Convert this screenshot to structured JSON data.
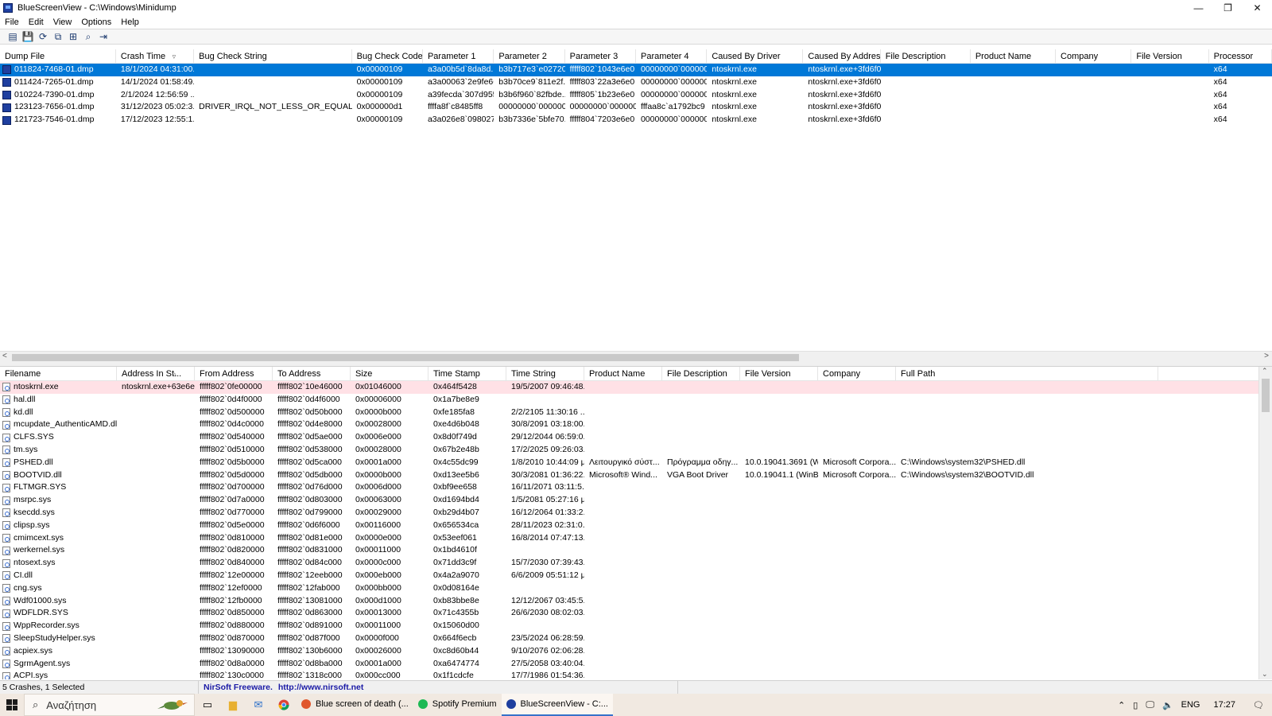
{
  "window": {
    "title": "BlueScreenView  -  C:\\Windows\\Minidump",
    "minimize": "—",
    "restore": "❐",
    "close": "✕"
  },
  "menu": [
    "File",
    "Edit",
    "View",
    "Options",
    "Help"
  ],
  "toolbar": {
    "buttons": [
      {
        "name": "html-report-icon",
        "glyph": "▤"
      },
      {
        "name": "save-icon",
        "glyph": "💾"
      },
      {
        "name": "refresh-icon",
        "glyph": "⟳"
      },
      {
        "name": "copy-icon",
        "glyph": "⧉"
      },
      {
        "name": "properties-icon",
        "glyph": "⊞"
      },
      {
        "name": "find-icon",
        "glyph": "⌕"
      },
      {
        "name": "exit-icon",
        "glyph": "⇥"
      }
    ]
  },
  "crashes": {
    "columns": [
      "Dump File",
      "Crash Time",
      "Bug Check String",
      "Bug Check Code",
      "Parameter 1",
      "Parameter 2",
      "Parameter 3",
      "Parameter 4",
      "Caused By Driver",
      "Caused By Address",
      "File Description",
      "Product Name",
      "Company",
      "File Version",
      "Processor"
    ],
    "sort_indicator": "▿",
    "rows": [
      [
        "011824-7468-01.dmp",
        "18/1/2024 04:31:00...",
        "",
        "0x00000109",
        "a3a00b5d`8da8d...",
        "b3b717e3`e02720...",
        "fffff802`1043e6e0",
        "00000000`000000...",
        "ntoskrnl.exe",
        "ntoskrnl.exe+3fd6f0",
        "",
        "",
        "",
        "",
        "x64"
      ],
      [
        "011424-7265-01.dmp",
        "14/1/2024 01:58:49...",
        "",
        "0x00000109",
        "a3a00063`2e9fe66c",
        "b3b70ce9`811e2f...",
        "fffff803`22a3e6e0",
        "00000000`000000...",
        "ntoskrnl.exe",
        "ntoskrnl.exe+3fd6f0",
        "",
        "",
        "",
        "",
        "x64"
      ],
      [
        "010224-7390-01.dmp",
        "2/1/2024 12:56:59 ...",
        "",
        "0x00000109",
        "a39fecda`307d955f",
        "b3b6f960`82fbde...",
        "fffff805`1b23e6e0",
        "00000000`000000...",
        "ntoskrnl.exe",
        "ntoskrnl.exe+3fd6f0",
        "",
        "",
        "",
        "",
        "x64"
      ],
      [
        "123123-7656-01.dmp",
        "31/12/2023 05:02:3...",
        "DRIVER_IRQL_NOT_LESS_OR_EQUAL",
        "0x000000d1",
        "ffffa8f`c8485ff8",
        "00000000`000000...",
        "00000000`000000...",
        "fffaa8c`a1792bc9",
        "ntoskrnl.exe",
        "ntoskrnl.exe+3fd6f0",
        "",
        "",
        "",
        "",
        "x64"
      ],
      [
        "121723-7546-01.dmp",
        "17/12/2023 12:55:1...",
        "",
        "0x00000109",
        "a3a026e8`098027...",
        "b3b7336e`5bfe70...",
        "fffff804`7203e6e0",
        "00000000`000000...",
        "ntoskrnl.exe",
        "ntoskrnl.exe+3fd6f0",
        "",
        "",
        "",
        "",
        "x64"
      ]
    ]
  },
  "drivers": {
    "columns": [
      "Filename",
      "Address In St...",
      "From Address",
      "To Address",
      "Size",
      "Time Stamp",
      "Time String",
      "Product Name",
      "File Description",
      "File Version",
      "Company",
      "Full Path"
    ],
    "sort_indicator": "▵",
    "rows": [
      [
        "ntoskrnl.exe",
        "ntoskrnl.exe+63e6e0",
        "fffff802`0fe00000",
        "fffff802`10e46000",
        "0x01046000",
        "0x464f5428",
        "19/5/2007 09:46:48...",
        "",
        "",
        "",
        "",
        ""
      ],
      [
        "hal.dll",
        "",
        "fffff802`0d4f0000",
        "fffff802`0d4f6000",
        "0x00006000",
        "0x1a7be8e9",
        "",
        "",
        "",
        "",
        "",
        ""
      ],
      [
        "kd.dll",
        "",
        "fffff802`0d500000",
        "fffff802`0d50b000",
        "0x0000b000",
        "0xfe185fa8",
        "2/2/2105 11:30:16 ...",
        "",
        "",
        "",
        "",
        ""
      ],
      [
        "mcupdate_AuthenticAMD.dll",
        "",
        "fffff802`0d4c0000",
        "fffff802`0d4e8000",
        "0x00028000",
        "0xe4d6b048",
        "30/8/2091 03:18:00...",
        "",
        "",
        "",
        "",
        ""
      ],
      [
        "CLFS.SYS",
        "",
        "fffff802`0d540000",
        "fffff802`0d5ae000",
        "0x0006e000",
        "0x8d0f749d",
        "29/12/2044 06:59:0...",
        "",
        "",
        "",
        "",
        ""
      ],
      [
        "tm.sys",
        "",
        "fffff802`0d510000",
        "fffff802`0d538000",
        "0x00028000",
        "0x67b2e48b",
        "17/2/2025 09:26:03...",
        "",
        "",
        "",
        "",
        ""
      ],
      [
        "PSHED.dll",
        "",
        "fffff802`0d5b0000",
        "fffff802`0d5ca000",
        "0x0001a000",
        "0x4c55dc99",
        "1/8/2010 10:44:09 μμ",
        "Λειτουργικό σύστ...",
        "Πρόγραμμα οδηγ...",
        "10.0.19041.3691 (W...",
        "Microsoft Corpora...",
        "C:\\Windows\\system32\\PSHED.dll"
      ],
      [
        "BOOTVID.dll",
        "",
        "fffff802`0d5d0000",
        "fffff802`0d5db000",
        "0x0000b000",
        "0xd13ee5b6",
        "30/3/2081 01:36:22...",
        "Microsoft® Wind...",
        "VGA Boot Driver",
        "10.0.19041.1 (WinB...",
        "Microsoft Corpora...",
        "C:\\Windows\\system32\\BOOTVID.dll"
      ],
      [
        "FLTMGR.SYS",
        "",
        "fffff802`0d700000",
        "fffff802`0d76d000",
        "0x0006d000",
        "0xbf9ee658",
        "16/11/2071 03:11:5...",
        "",
        "",
        "",
        "",
        ""
      ],
      [
        "msrpc.sys",
        "",
        "fffff802`0d7a0000",
        "fffff802`0d803000",
        "0x00063000",
        "0xd1694bd4",
        "1/5/2081 05:27:16 μμ",
        "",
        "",
        "",
        "",
        ""
      ],
      [
        "ksecdd.sys",
        "",
        "fffff802`0d770000",
        "fffff802`0d799000",
        "0x00029000",
        "0xb29d4b07",
        "16/12/2064 01:33:2...",
        "",
        "",
        "",
        "",
        ""
      ],
      [
        "clipsp.sys",
        "",
        "fffff802`0d5e0000",
        "fffff802`0d6f6000",
        "0x00116000",
        "0x656534ca",
        "28/11/2023 02:31:0...",
        "",
        "",
        "",
        "",
        ""
      ],
      [
        "cmimcext.sys",
        "",
        "fffff802`0d810000",
        "fffff802`0d81e000",
        "0x0000e000",
        "0x53eef061",
        "16/8/2014 07:47:13...",
        "",
        "",
        "",
        "",
        ""
      ],
      [
        "werkernel.sys",
        "",
        "fffff802`0d820000",
        "fffff802`0d831000",
        "0x00011000",
        "0x1bd4610f",
        "",
        "",
        "",
        "",
        "",
        ""
      ],
      [
        "ntosext.sys",
        "",
        "fffff802`0d840000",
        "fffff802`0d84c000",
        "0x0000c000",
        "0x71dd3c9f",
        "15/7/2030 07:39:43...",
        "",
        "",
        "",
        "",
        ""
      ],
      [
        "CI.dll",
        "",
        "fffff802`12e00000",
        "fffff802`12eeb000",
        "0x000eb000",
        "0x4a2a9070",
        "6/6/2009 05:51:12 μμ",
        "",
        "",
        "",
        "",
        ""
      ],
      [
        "cng.sys",
        "",
        "fffff802`12ef0000",
        "fffff802`12fab000",
        "0x000bb000",
        "0x0d08164e",
        "",
        "",
        "",
        "",
        "",
        ""
      ],
      [
        "Wdf01000.sys",
        "",
        "fffff802`12fb0000",
        "fffff802`13081000",
        "0x000d1000",
        "0xb83bbe8e",
        "12/12/2067 03:45:5...",
        "",
        "",
        "",
        "",
        ""
      ],
      [
        "WDFLDR.SYS",
        "",
        "fffff802`0d850000",
        "fffff802`0d863000",
        "0x00013000",
        "0x71c4355b",
        "26/6/2030 08:02:03...",
        "",
        "",
        "",
        "",
        ""
      ],
      [
        "WppRecorder.sys",
        "",
        "fffff802`0d880000",
        "fffff802`0d891000",
        "0x00011000",
        "0x15060d00",
        "",
        "",
        "",
        "",
        "",
        ""
      ],
      [
        "SleepStudyHelper.sys",
        "",
        "fffff802`0d870000",
        "fffff802`0d87f000",
        "0x0000f000",
        "0x664f6ecb",
        "23/5/2024 06:28:59...",
        "",
        "",
        "",
        "",
        ""
      ],
      [
        "acpiex.sys",
        "",
        "fffff802`13090000",
        "fffff802`130b6000",
        "0x00026000",
        "0xc8d60b44",
        "9/10/2076 02:06:28...",
        "",
        "",
        "",
        "",
        ""
      ],
      [
        "SgrmAgent.sys",
        "",
        "fffff802`0d8a0000",
        "fffff802`0d8ba000",
        "0x0001a000",
        "0xa6474774",
        "27/5/2058 03:40:04...",
        "",
        "",
        "",
        "",
        ""
      ],
      [
        "ACPI.sys",
        "",
        "fffff802`130c0000",
        "fffff802`1318c000",
        "0x000cc000",
        "0x1f1cdcfe",
        "17/7/1986 01:54:36...",
        "",
        "",
        "",
        "",
        ""
      ]
    ]
  },
  "status": {
    "left": "5 Crashes, 1 Selected",
    "freeware": "NirSoft Freeware.",
    "url": "http://www.nirsoft.net"
  },
  "taskbar": {
    "search_placeholder": "Αναζήτηση",
    "tasks": [
      {
        "label": "Blue screen of death (...",
        "color": "#e0572d",
        "active": false
      },
      {
        "label": "Spotify Premium",
        "color": "#1db954",
        "active": false
      },
      {
        "label": "BlueScreenView - C:...",
        "color": "#1f3f9f",
        "active": true
      }
    ],
    "tray": {
      "chevron": "⌃",
      "lang": "ENG",
      "time": "17:27"
    }
  }
}
